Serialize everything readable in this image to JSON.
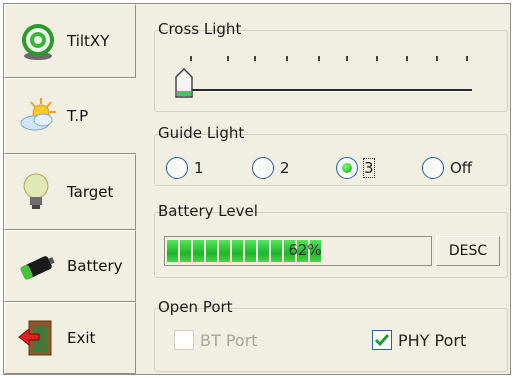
{
  "sidebar": {
    "items": [
      {
        "label": "TiltXY",
        "icon": "tilt-target-icon"
      },
      {
        "label": "T.P",
        "icon": "weather-sun-cloud-icon"
      },
      {
        "label": "Target",
        "icon": "lightbulb-icon"
      },
      {
        "label": "Battery",
        "icon": "battery-icon"
      },
      {
        "label": "Exit",
        "icon": "exit-door-icon"
      }
    ]
  },
  "cross_light": {
    "title": "Cross Light",
    "level": 0
  },
  "guide_light": {
    "title": "Guide Light",
    "options": [
      "1",
      "2",
      "3",
      "Off"
    ],
    "selected": "3"
  },
  "battery": {
    "title": "Battery Level",
    "percent_text": "62%",
    "percent": 62,
    "desc_label": "DESC"
  },
  "open_port": {
    "title": "Open Port",
    "bt_label": "BT Port",
    "bt_checked": false,
    "bt_disabled": true,
    "phy_label": "PHY Port",
    "phy_checked": true
  },
  "colors": {
    "background": "#f1efe2",
    "progress_green": "#2ec236",
    "radio_border": "#2a5fa8"
  }
}
